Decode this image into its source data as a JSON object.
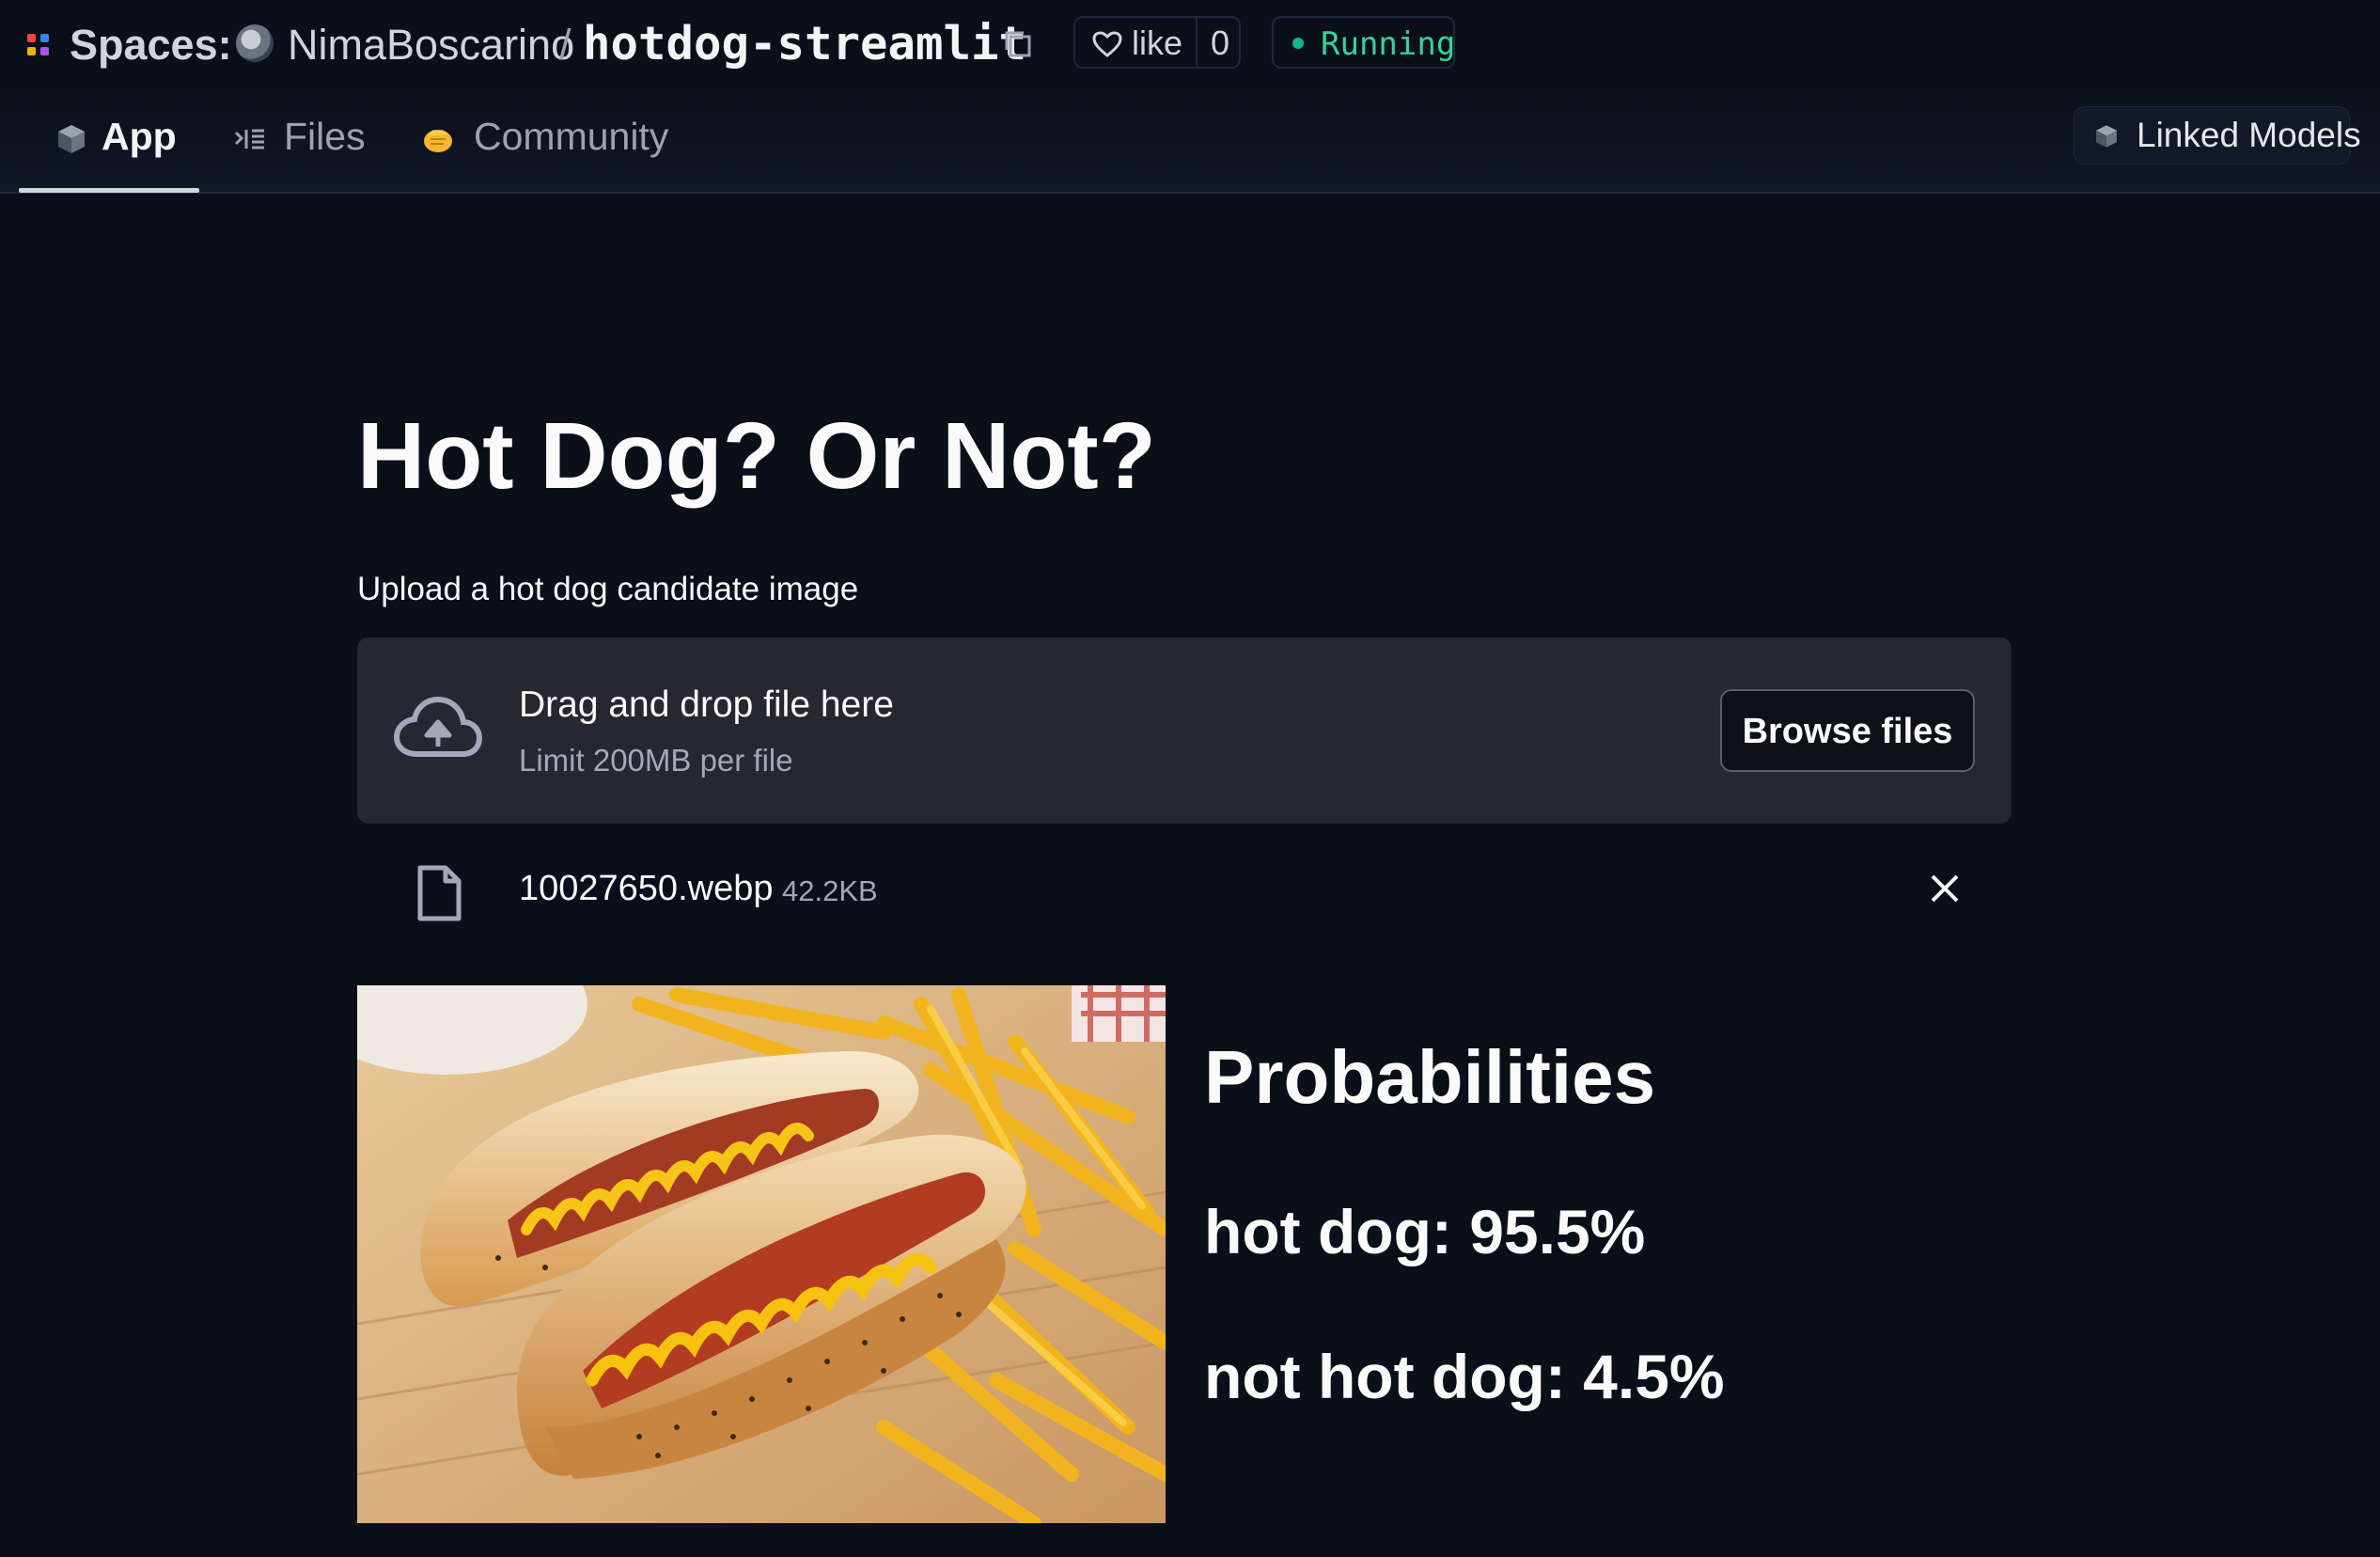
{
  "header": {
    "spaces_label": "Spaces:",
    "owner": "NimaBoscarino",
    "separator": "/",
    "repo": "hotdog-streamlit",
    "like_label": "like",
    "like_count": "0",
    "status": "Running",
    "status_color": "#10b981"
  },
  "tabs": [
    {
      "label": "App",
      "icon": "cube-icon",
      "active": true
    },
    {
      "label": "Files",
      "icon": "files-icon",
      "active": false
    },
    {
      "label": "Community",
      "icon": "community-emoji-icon",
      "active": false
    }
  ],
  "linked_models_label": "Linked Models",
  "main": {
    "title": "Hot Dog? Or Not?",
    "uploader_label": "Upload a hot dog candidate image",
    "dropzone_title": "Drag and drop file here",
    "dropzone_limit": "Limit 200MB per file",
    "browse_label": "Browse files",
    "file_name": "10027650.webp",
    "file_size": "42.2KB"
  },
  "results": {
    "heading": "Probabilities",
    "hot_dog": "hot dog: 95.5%",
    "not_hot_dog": "not hot dog: 4.5%"
  }
}
